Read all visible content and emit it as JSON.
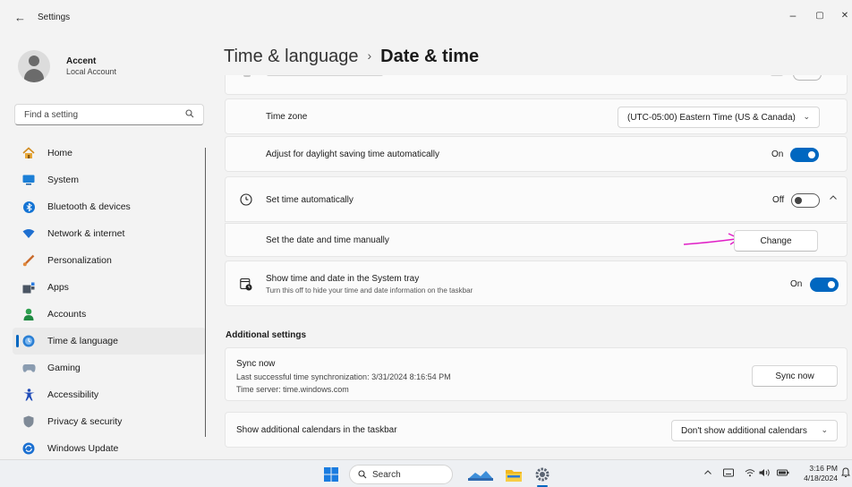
{
  "window": {
    "app_title": "Settings",
    "controls": {
      "minimize": "–",
      "maximize": "▢",
      "close": "✕"
    }
  },
  "profile": {
    "name": "Accent",
    "account_type": "Local Account"
  },
  "search": {
    "placeholder": "Find a setting",
    "icon": "search-icon"
  },
  "sidebar": {
    "items": [
      {
        "label": "Home",
        "icon": "home-icon",
        "active": false
      },
      {
        "label": "System",
        "icon": "system-icon",
        "active": false
      },
      {
        "label": "Bluetooth & devices",
        "icon": "bluetooth-icon",
        "active": false
      },
      {
        "label": "Network & internet",
        "icon": "wifi-icon",
        "active": false
      },
      {
        "label": "Personalization",
        "icon": "brush-icon",
        "active": false
      },
      {
        "label": "Apps",
        "icon": "apps-icon",
        "active": false
      },
      {
        "label": "Accounts",
        "icon": "accounts-icon",
        "active": false
      },
      {
        "label": "Time & language",
        "icon": "time-language-icon",
        "active": true
      },
      {
        "label": "Gaming",
        "icon": "gaming-icon",
        "active": false
      },
      {
        "label": "Accessibility",
        "icon": "accessibility-icon",
        "active": false
      },
      {
        "label": "Privacy & security",
        "icon": "shield-icon",
        "active": false
      },
      {
        "label": "Windows Update",
        "icon": "update-icon",
        "active": false
      }
    ]
  },
  "header": {
    "crumb": "Time & language",
    "separator": "›",
    "current": "Date & time"
  },
  "rows": {
    "time_zone": {
      "label": "Time zone",
      "value": "(UTC-05:00) Eastern Time (US & Canada)"
    },
    "daylight": {
      "label": "Adjust for daylight saving time automatically",
      "state_text": "On",
      "on": true
    },
    "set_auto": {
      "label": "Set time automatically",
      "state_text": "Off",
      "on": false
    },
    "manual": {
      "label": "Set the date and time manually",
      "button": "Change"
    },
    "tray": {
      "label": "Show time and date in the System tray",
      "sub": "Turn this off to hide your time and date information on the taskbar",
      "state_text": "On",
      "on": true
    }
  },
  "additional": {
    "heading": "Additional settings",
    "sync": {
      "title": "Sync now",
      "last_sync": "Last successful time synchronization: 3/31/2024 8:16:54 PM",
      "server": "Time server: time.windows.com",
      "button": "Sync now"
    },
    "calendars": {
      "label": "Show additional calendars in the taskbar",
      "value": "Don't show additional calendars"
    }
  },
  "taskbar": {
    "search_label": "Search",
    "time": "3:16 PM",
    "date": "4/18/2024"
  },
  "colors": {
    "accent": "#0067c0",
    "annotation_arrow": "#e01fc6"
  }
}
